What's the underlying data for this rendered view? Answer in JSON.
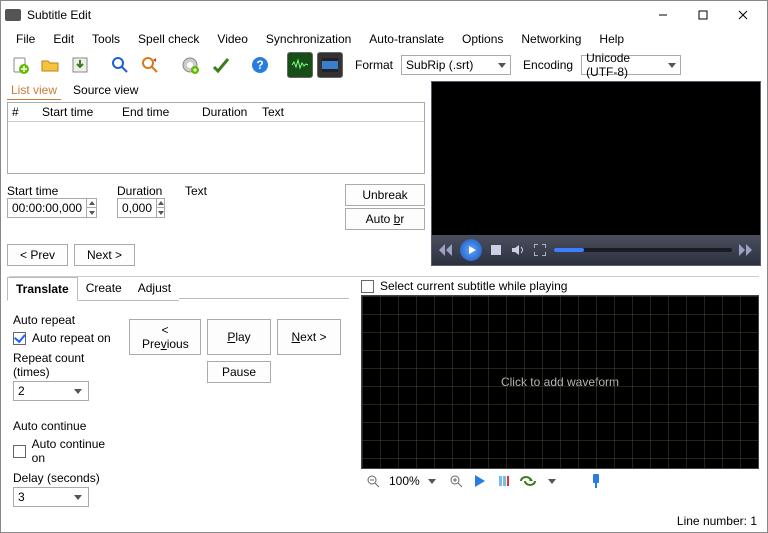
{
  "title": "Subtitle Edit",
  "menu": [
    "File",
    "Edit",
    "Tools",
    "Spell check",
    "Video",
    "Synchronization",
    "Auto-translate",
    "Options",
    "Networking",
    "Help"
  ],
  "toolbar": {
    "format_label": "Format",
    "format_value": "SubRip (.srt)",
    "encoding_label": "Encoding",
    "encoding_value": "Unicode (UTF-8)"
  },
  "list_tabs": {
    "list_view": "List view",
    "source_view": "Source view"
  },
  "grid_headers": {
    "num": "#",
    "start": "Start time",
    "end": "End time",
    "duration": "Duration",
    "text": "Text"
  },
  "edit": {
    "start_label": "Start time",
    "start_value": "00:00:00,000",
    "duration_label": "Duration",
    "duration_value": "0,000",
    "text_label": "Text",
    "unbreak": "Unbreak",
    "autobr_pre": "Auto ",
    "autobr_u": "b",
    "autobr_post": "r",
    "prev": "< Prev",
    "next": "Next >"
  },
  "lower_tabs": {
    "translate": "Translate",
    "create": "Create",
    "adjust": "Adjust"
  },
  "translate": {
    "auto_repeat_h": "Auto repeat",
    "auto_repeat_on": "Auto repeat on",
    "repeat_count_label": "Repeat count (times)",
    "repeat_count_value": "2",
    "auto_continue_h": "Auto continue",
    "auto_continue_on": "Auto continue on",
    "delay_label": "Delay (seconds)",
    "delay_value": "3",
    "btn_prev_pre": "< Pre",
    "btn_prev_u": "v",
    "btn_prev_post": "ious",
    "btn_play_pre": "",
    "btn_play_u": "P",
    "btn_play_post": "lay",
    "btn_next_pre": "",
    "btn_next_u": "N",
    "btn_next_post": "ext >",
    "btn_pause": "Pause"
  },
  "waveform": {
    "select_current": "Select current subtitle while playing",
    "placeholder": "Click to add waveform",
    "zoom_pct": "100%"
  },
  "status": {
    "line_number_label": "Line number: ",
    "line_number_value": "1"
  }
}
